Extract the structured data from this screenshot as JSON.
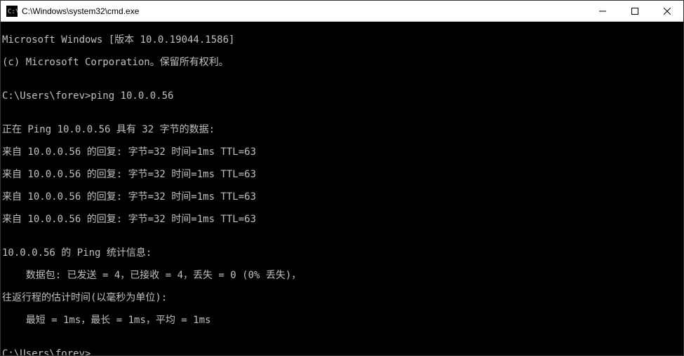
{
  "window": {
    "title": "C:\\Windows\\system32\\cmd.exe"
  },
  "terminal": {
    "header1": "Microsoft Windows [版本 10.0.19044.1586]",
    "header2": "(c) Microsoft Corporation。保留所有权利。",
    "blank": "",
    "prompt1": "C:\\Users\\forev>ping 10.0.0.56",
    "pinging": "正在 Ping 10.0.0.56 具有 32 字节的数据:",
    "reply1": "来自 10.0.0.56 的回复: 字节=32 时间=1ms TTL=63",
    "reply2": "来自 10.0.0.56 的回复: 字节=32 时间=1ms TTL=63",
    "reply3": "来自 10.0.0.56 的回复: 字节=32 时间=1ms TTL=63",
    "reply4": "来自 10.0.0.56 的回复: 字节=32 时间=1ms TTL=63",
    "stats_header": "10.0.0.56 的 Ping 统计信息:",
    "stats_packets": "    数据包: 已发送 = 4，已接收 = 4，丢失 = 0 (0% 丢失)，",
    "stats_time_header": "往返行程的估计时间(以毫秒为单位):",
    "stats_time": "    最短 = 1ms，最长 = 1ms，平均 = 1ms",
    "prompt2": "C:\\Users\\forev>"
  }
}
